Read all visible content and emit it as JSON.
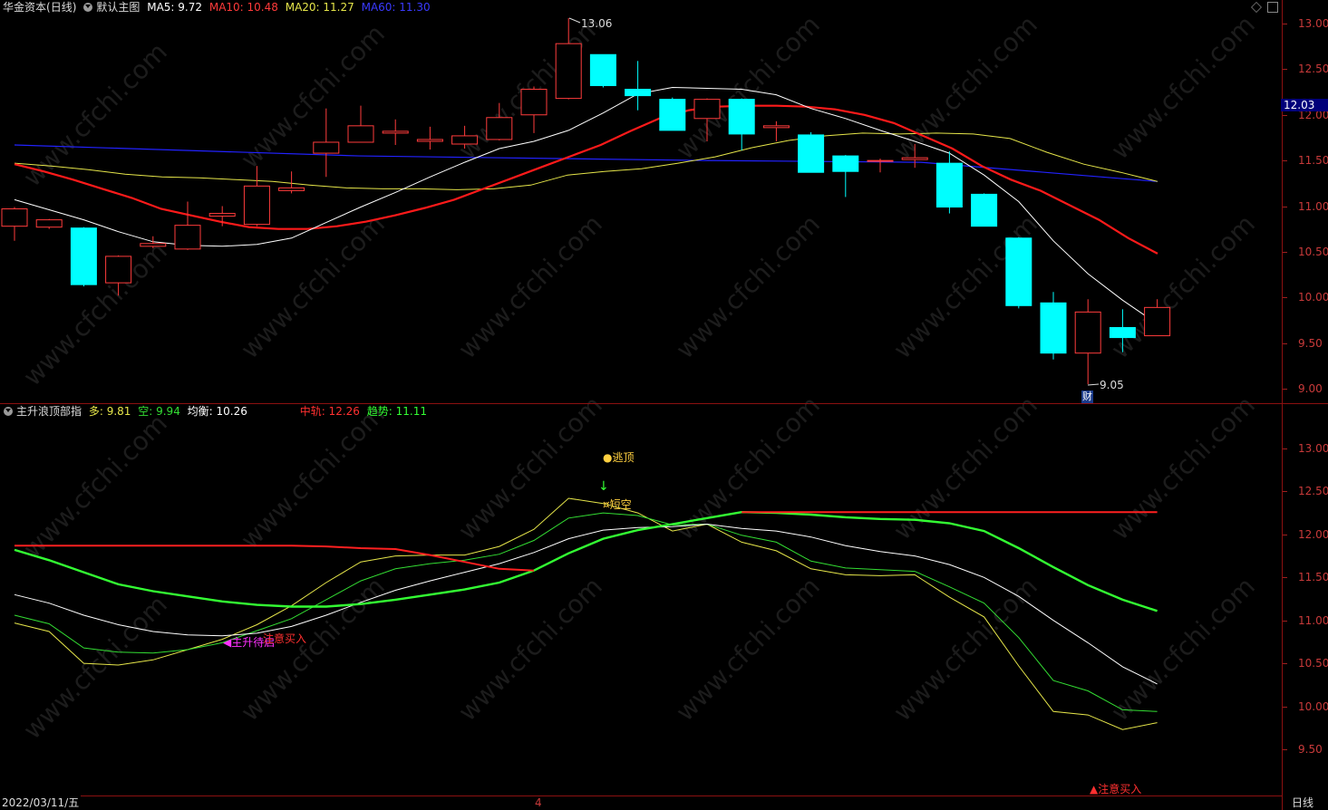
{
  "main_panel": {
    "stock_name": "华金资本",
    "period": "(日线)",
    "chart_name": "默认主图",
    "ma5": "MA5: 9.72",
    "ma10": "MA10: 10.48",
    "ma20": "MA20: 11.27",
    "ma60": "MA60: 11.30",
    "high_label": "13.06",
    "low_label": "9.05",
    "fin_marker": "财",
    "current_price": "12.03",
    "y_ticks": [
      "13.00",
      "12.50",
      "12.00",
      "11.50",
      "11.00",
      "10.50",
      "10.00",
      "9.50",
      "9.00"
    ],
    "y_values": [
      13.0,
      12.5,
      12.0,
      11.5,
      11.0,
      10.5,
      10.0,
      9.5,
      9.0
    ]
  },
  "indicator_panel": {
    "name": "主升浪顶部指",
    "duo": "多: 9.81",
    "kong": "空: 9.94",
    "junheng": "均衡: 10.26",
    "zhonggui": "中轨: 12.26",
    "qushi": "趋势: 11.11",
    "y_ticks": [
      "13.00",
      "12.50",
      "12.00",
      "11.50",
      "11.00",
      "10.50",
      "10.00",
      "9.50"
    ],
    "y_values": [
      13.0,
      12.5,
      12.0,
      11.5,
      11.0,
      10.5,
      10.0,
      9.5
    ],
    "annotations": {
      "escape_top": "逃顶",
      "short_empty": "短空",
      "main_rise": "主升待启",
      "watch_buy_1": "注意买入",
      "watch_buy_2": "注意买入"
    }
  },
  "footer": {
    "date": "2022/03/11/五",
    "month_marker": "4",
    "period_button": "日线"
  },
  "watermark": "www.cfchi.com",
  "colors": {
    "up": "#ff3c3c",
    "down": "#00ffff",
    "ma5": "#ffffff",
    "ma10": "#ff1a1a",
    "ma20": "#e6e64a",
    "ma60": "#2222ff",
    "ind_duo": "#e6e64a",
    "ind_kong": "#33dd33",
    "ind_trend": "#33ff33",
    "ind_zhonggui": "#ff2020",
    "ind_junheng": "#ffffff"
  },
  "chart_data": [
    {
      "type": "candlestick",
      "title": "华金资本 (日线)",
      "candles": [
        {
          "o": 10.78,
          "c": 10.97,
          "h": 10.99,
          "l": 10.62
        },
        {
          "o": 10.77,
          "c": 10.85,
          "h": 10.86,
          "l": 10.75
        },
        {
          "o": 10.76,
          "c": 10.14,
          "h": 10.77,
          "l": 10.12
        },
        {
          "o": 10.16,
          "c": 10.45,
          "h": 10.46,
          "l": 10.02
        },
        {
          "o": 10.56,
          "c": 10.59,
          "h": 10.67,
          "l": 10.54
        },
        {
          "o": 10.53,
          "c": 10.79,
          "h": 11.05,
          "l": 10.52
        },
        {
          "o": 10.89,
          "c": 10.92,
          "h": 11.0,
          "l": 10.78
        },
        {
          "o": 10.8,
          "c": 11.22,
          "h": 11.44,
          "l": 10.78
        },
        {
          "o": 11.17,
          "c": 11.2,
          "h": 11.38,
          "l": 11.14
        },
        {
          "o": 11.58,
          "c": 11.7,
          "h": 12.07,
          "l": 11.32
        },
        {
          "o": 11.7,
          "c": 11.88,
          "h": 12.1,
          "l": 11.7
        },
        {
          "o": 11.8,
          "c": 11.82,
          "h": 11.95,
          "l": 11.67
        },
        {
          "o": 11.71,
          "c": 11.73,
          "h": 11.87,
          "l": 11.62
        },
        {
          "o": 11.68,
          "c": 11.77,
          "h": 11.88,
          "l": 11.63
        },
        {
          "o": 11.73,
          "c": 11.97,
          "h": 12.13,
          "l": 11.72
        },
        {
          "o": 12.0,
          "c": 12.28,
          "h": 12.31,
          "l": 11.8
        },
        {
          "o": 12.18,
          "c": 12.78,
          "h": 13.06,
          "l": 12.17
        },
        {
          "o": 12.66,
          "c": 12.32,
          "h": 12.66,
          "l": 12.3
        },
        {
          "o": 12.28,
          "c": 12.21,
          "h": 12.59,
          "l": 12.05
        },
        {
          "o": 12.17,
          "c": 11.83,
          "h": 12.19,
          "l": 11.83
        },
        {
          "o": 11.96,
          "c": 12.17,
          "h": 12.18,
          "l": 11.71
        },
        {
          "o": 12.17,
          "c": 11.79,
          "h": 12.18,
          "l": 11.61
        },
        {
          "o": 11.86,
          "c": 11.88,
          "h": 11.93,
          "l": 11.71
        },
        {
          "o": 11.78,
          "c": 11.37,
          "h": 11.81,
          "l": 11.37
        },
        {
          "o": 11.55,
          "c": 11.38,
          "h": 11.56,
          "l": 11.1
        },
        {
          "o": 11.49,
          "c": 11.5,
          "h": 11.52,
          "l": 11.37
        },
        {
          "o": 11.51,
          "c": 11.53,
          "h": 11.68,
          "l": 11.42
        },
        {
          "o": 11.47,
          "c": 10.99,
          "h": 11.6,
          "l": 10.92
        },
        {
          "o": 11.13,
          "c": 10.78,
          "h": 11.14,
          "l": 10.78
        },
        {
          "o": 10.65,
          "c": 9.91,
          "h": 10.66,
          "l": 9.88
        },
        {
          "o": 9.94,
          "c": 9.39,
          "h": 10.06,
          "l": 9.32
        },
        {
          "o": 9.39,
          "c": 9.84,
          "h": 9.98,
          "l": 9.05
        },
        {
          "o": 9.67,
          "c": 9.56,
          "h": 9.87,
          "l": 9.4
        },
        {
          "o": 9.58,
          "c": 9.89,
          "h": 9.98,
          "l": 9.58
        }
      ],
      "ma5": [
        11.07,
        10.96,
        10.85,
        10.72,
        10.61,
        10.57,
        10.56,
        10.58,
        10.65,
        10.82,
        10.99,
        11.15,
        11.32,
        11.48,
        11.63,
        11.71,
        11.83,
        12.02,
        12.23,
        12.3,
        12.29,
        12.28,
        12.22,
        12.07,
        11.96,
        11.83,
        11.71,
        11.58,
        11.34,
        11.05,
        10.62,
        10.26,
        9.97,
        9.71
      ],
      "ma10": [
        11.46,
        11.38,
        11.29,
        11.19,
        11.09,
        10.97,
        10.9,
        10.83,
        10.77,
        10.75,
        10.75,
        10.78,
        10.83,
        10.9,
        10.98,
        11.07,
        11.19,
        11.31,
        11.43,
        11.55,
        11.67,
        11.82,
        11.96,
        12.05,
        12.09,
        12.1,
        12.1,
        12.09,
        12.06,
        12.0,
        11.91,
        11.77,
        11.63,
        11.44,
        11.29,
        11.17,
        11.01,
        10.85,
        10.65,
        10.48
      ]
    },
    {
      "type": "line",
      "title": "主升浪顶部指",
      "series": [
        {
          "name": "多",
          "values": [
            10.97,
            10.87,
            10.5,
            10.48,
            10.54,
            10.66,
            10.78,
            10.95,
            11.17,
            11.44,
            11.68,
            11.75,
            11.76,
            11.76,
            11.86,
            12.06,
            12.42,
            12.36,
            12.25,
            12.04,
            12.12,
            11.91,
            11.81,
            11.6,
            11.53,
            11.52,
            11.53,
            11.27,
            11.04,
            10.47,
            9.94,
            9.9,
            9.73,
            9.81
          ]
        },
        {
          "name": "空",
          "values": [
            11.06,
            10.96,
            10.68,
            10.63,
            10.62,
            10.66,
            10.74,
            10.88,
            11.02,
            11.24,
            11.46,
            11.6,
            11.66,
            11.7,
            11.77,
            11.93,
            12.19,
            12.25,
            12.22,
            12.11,
            12.12,
            11.99,
            11.91,
            11.69,
            11.61,
            11.59,
            11.57,
            11.39,
            11.2,
            10.8,
            10.3,
            10.18,
            9.96,
            9.94
          ]
        },
        {
          "name": "均衡",
          "values": [
            11.3,
            11.2,
            11.06,
            10.95,
            10.87,
            10.83,
            10.82,
            10.85,
            10.93,
            11.06,
            11.21,
            11.35,
            11.46,
            11.56,
            11.66,
            11.79,
            11.95,
            12.05,
            12.08,
            12.09,
            12.12,
            12.07,
            12.04,
            11.97,
            11.87,
            11.8,
            11.75,
            11.65,
            11.5,
            11.28,
            11.0,
            10.74,
            10.46,
            10.26
          ]
        },
        {
          "name": "趋势",
          "values": [
            11.82,
            11.7,
            11.56,
            11.42,
            11.34,
            11.28,
            11.22,
            11.18,
            11.16,
            11.16,
            11.19,
            11.24,
            11.3,
            11.36,
            11.44,
            11.58,
            11.78,
            11.95,
            12.05,
            12.12,
            12.19,
            12.26,
            12.25,
            12.23,
            12.2,
            12.18,
            12.17,
            12.13,
            12.04,
            11.84,
            11.62,
            11.41,
            11.24,
            11.11
          ]
        },
        {
          "name": "中轨",
          "values": [
            11.87,
            11.87,
            11.87,
            11.87,
            11.87,
            11.87,
            11.87,
            11.87,
            11.87,
            11.86,
            11.84,
            11.83,
            11.76,
            11.68,
            11.6,
            11.58,
            null,
            null,
            null,
            null,
            null,
            12.26,
            12.26,
            12.26,
            12.26,
            12.26,
            12.26,
            12.26,
            12.26,
            12.26,
            12.26,
            12.26,
            12.26,
            12.26
          ]
        }
      ]
    }
  ]
}
